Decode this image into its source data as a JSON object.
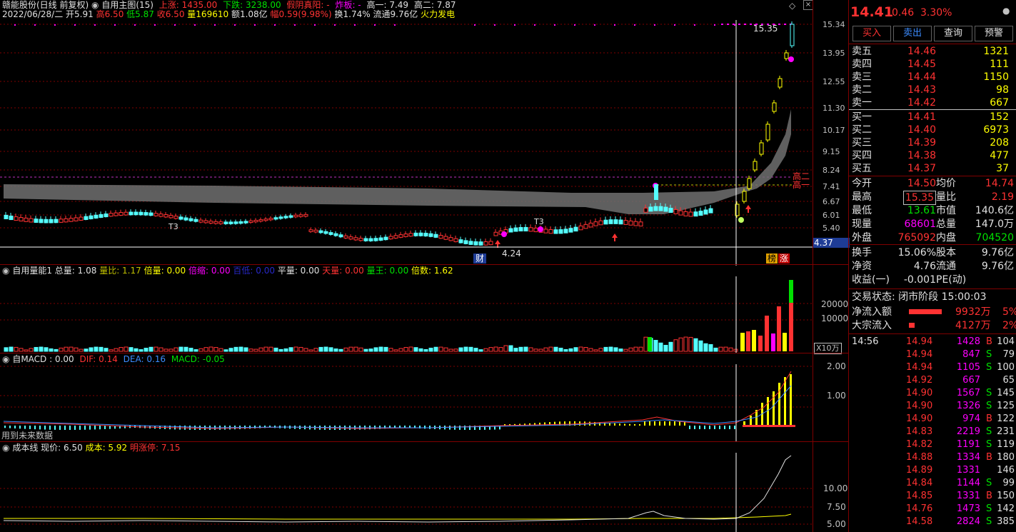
{
  "colors": {
    "up": "#ff3232",
    "down": "#00e000",
    "flat": "#c0c0c0",
    "yellow": "#ffff00",
    "magenta": "#ff00ff",
    "cyan": "#54ffff",
    "white": "#ffffff",
    "grid": "#800000"
  },
  "header": {
    "stock_name": "赣能股份(日线 前复权)",
    "indicator": "自用主图(15)",
    "rise": "上涨: 1435.00",
    "fall": "下跌: 3238.00",
    "yinyang": "假阴真阳: -",
    "zhaban": "炸板: -",
    "high1": "高一: 7.49",
    "high2": "高二: 7.87",
    "date": "2022/06/28/二",
    "open": "开5.91",
    "high": "高6.50",
    "low": "低5.87",
    "close": "收6.50",
    "volume": "量169610",
    "amount": "额1.08亿",
    "change": "幅0.59(9.98%)",
    "turnover": "换1.74%",
    "float": "流通9.76亿",
    "concept": "火力发电"
  },
  "main_chart": {
    "price_axis": [
      "15.34",
      "13.95",
      "12.55",
      "11.30",
      "10.17",
      "9.15",
      "8.24",
      "7.41",
      "6.67",
      "6.01",
      "5.40"
    ],
    "cursor_price": "4.37",
    "high_label": "15.35",
    "low_label": "4.24",
    "t3_labels": [
      "T3",
      "T3"
    ],
    "high1_tag": "高一",
    "high2_tag": "高二",
    "badge_cai": "财",
    "badge_bang": "榜",
    "badge_zhang": "涨"
  },
  "volume_panel": {
    "title": "自用量能1",
    "zongliang": "总量: 1.08",
    "liangbi": "量比: 1.17",
    "beiliang": "倍量: 0.00",
    "beisuo": "倍缩: 0.00",
    "baidi": "百低: 0.00",
    "pingliang": "平量: 0.00",
    "tianliang": "天量: 0.00",
    "liangwang": "量王: 0.00",
    "beishu": "倍数: 1.62",
    "axis": [
      "20000",
      "10000"
    ],
    "unit": "X10万"
  },
  "macd_panel": {
    "title": "自MACD : 0.00",
    "dif": "DIF: 0.14",
    "dea": "DEA: 0.16",
    "macd": "MACD: -0.05",
    "axis": [
      "2.00",
      "1.00"
    ],
    "future_note": "用到未来数据"
  },
  "cost_panel": {
    "title": "成本线",
    "xianjia": "现价: 6.50",
    "chengben": "成本: 5.92",
    "mingzhangting": "明涨停: 7.15",
    "axis": [
      "10.00",
      "7.50",
      "5.00"
    ]
  },
  "quote": {
    "price": "14.41",
    "change": "0.46",
    "pct": "3.30%",
    "buttons": {
      "buy": "买入",
      "sell": "卖出",
      "query": "查询",
      "alert": "预警"
    },
    "asks": [
      {
        "label": "卖五",
        "price": "14.46",
        "vol": "1321"
      },
      {
        "label": "卖四",
        "price": "14.45",
        "vol": "111"
      },
      {
        "label": "卖三",
        "price": "14.44",
        "vol": "1150"
      },
      {
        "label": "卖二",
        "price": "14.43",
        "vol": "98"
      },
      {
        "label": "卖一",
        "price": "14.42",
        "vol": "667"
      }
    ],
    "bids": [
      {
        "label": "买一",
        "price": "14.41",
        "vol": "152"
      },
      {
        "label": "买二",
        "price": "14.40",
        "vol": "6973"
      },
      {
        "label": "买三",
        "price": "14.39",
        "vol": "208"
      },
      {
        "label": "买四",
        "price": "14.38",
        "vol": "477"
      },
      {
        "label": "买五",
        "price": "14.37",
        "vol": "37"
      }
    ],
    "stats": [
      {
        "l1": "今开",
        "v1": "14.50",
        "l2": "均价",
        "v2": "14.74",
        "c1": "#ff3232",
        "c2": "#ff3232"
      },
      {
        "l1": "最高",
        "v1": "15.35",
        "l2": "量比",
        "v2": "2.19",
        "c1": "#ff3232",
        "c2": "#ff3232"
      },
      {
        "l1": "最低",
        "v1": "13.61",
        "l2": "市值",
        "v2": "140.6亿",
        "c1": "#00e000",
        "c2": "#e0e0e0"
      },
      {
        "l1": "现量",
        "v1": "68601",
        "l2": "总量",
        "v2": "147.0万",
        "c1": "#ff00ff",
        "c2": "#e0e0e0"
      },
      {
        "l1": "外盘",
        "v1": "765092",
        "l2": "内盘",
        "v2": "704520",
        "c1": "#ff3232",
        "c2": "#00e000"
      }
    ],
    "stats2": [
      {
        "l1": "换手",
        "v1": "15.06%",
        "l2": "股本",
        "v2": "9.76亿"
      },
      {
        "l1": "净资",
        "v1": "4.76",
        "l2": "流通",
        "v2": "9.76亿"
      },
      {
        "l1": "收益(一)",
        "v1": "-0.001",
        "l2": "PE(动)",
        "v2": ""
      }
    ],
    "trade_status": "交易状态: 闭市阶段 15:00:03",
    "net_inflow": {
      "label": "净流入额",
      "value": "9932万",
      "pct": "5%"
    },
    "block_inflow": {
      "label": "大宗流入",
      "value": "4127万",
      "pct": "2%"
    },
    "ticks": [
      {
        "time": "14:56",
        "price": "14.94",
        "vol": "1428",
        "bs": "B",
        "n": "104"
      },
      {
        "time": "",
        "price": "14.94",
        "vol": "847",
        "bs": "S",
        "n": "79"
      },
      {
        "time": "",
        "price": "14.94",
        "vol": "1105",
        "bs": "S",
        "n": "100"
      },
      {
        "time": "",
        "price": "14.92",
        "vol": "667",
        "bs": "",
        "n": "65"
      },
      {
        "time": "",
        "price": "14.90",
        "vol": "1567",
        "bs": "S",
        "n": "145"
      },
      {
        "time": "",
        "price": "14.90",
        "vol": "1326",
        "bs": "S",
        "n": "125"
      },
      {
        "time": "",
        "price": "14.90",
        "vol": "974",
        "bs": "B",
        "n": "122"
      },
      {
        "time": "",
        "price": "14.83",
        "vol": "2219",
        "bs": "S",
        "n": "231"
      },
      {
        "time": "",
        "price": "14.82",
        "vol": "1191",
        "bs": "S",
        "n": "119"
      },
      {
        "time": "",
        "price": "14.88",
        "vol": "1334",
        "bs": "B",
        "n": "180"
      },
      {
        "time": "",
        "price": "14.89",
        "vol": "1331",
        "bs": "",
        "n": "146"
      },
      {
        "time": "",
        "price": "14.84",
        "vol": "1144",
        "bs": "S",
        "n": "99"
      },
      {
        "time": "",
        "price": "14.85",
        "vol": "1331",
        "bs": "B",
        "n": "150"
      },
      {
        "time": "",
        "price": "14.76",
        "vol": "1473",
        "bs": "S",
        "n": "142"
      },
      {
        "time": "",
        "price": "14.58",
        "vol": "2824",
        "bs": "S",
        "n": "385"
      }
    ]
  }
}
